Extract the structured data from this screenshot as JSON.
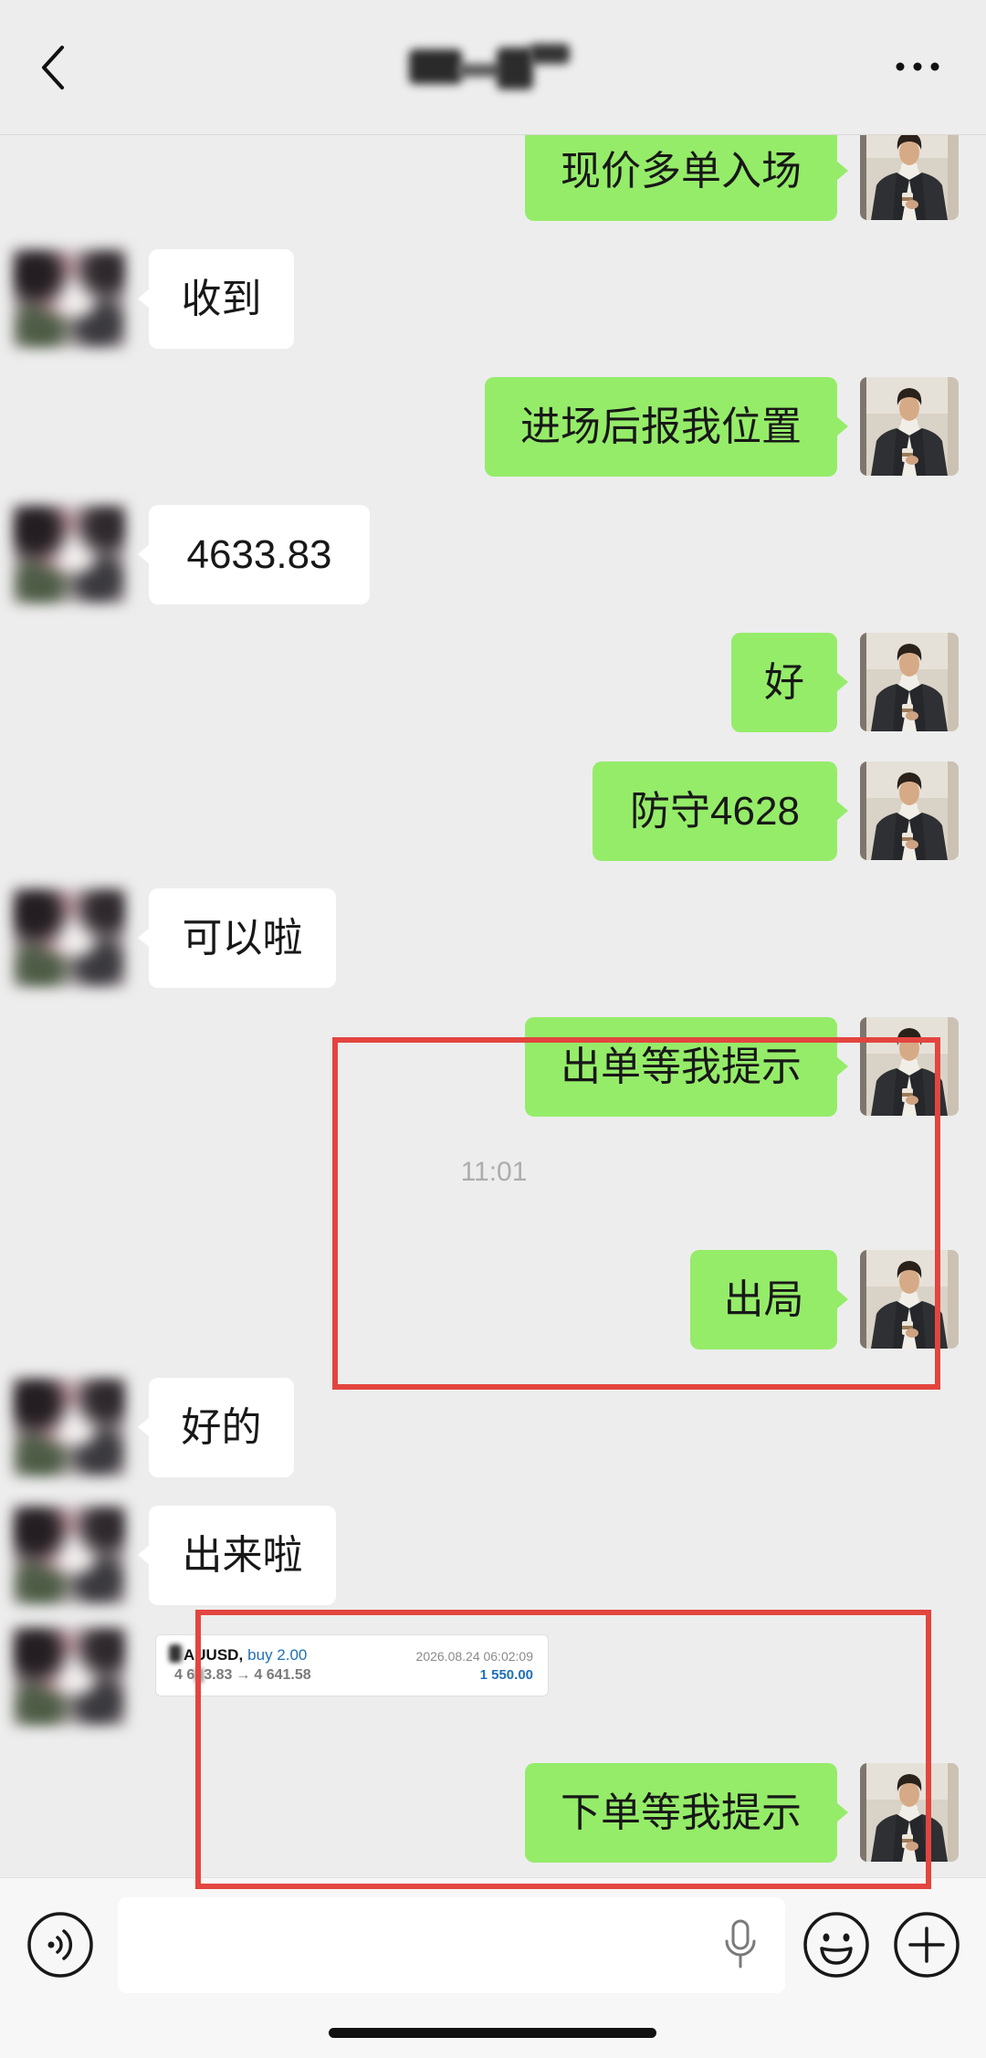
{
  "icons": {
    "back": "chevron-left-icon",
    "more": "more-icon",
    "voice": "voice-icon",
    "mic": "mic-icon",
    "emoji": "emoji-icon",
    "plus": "plus-icon"
  },
  "colors": {
    "background": "#ededed",
    "my_bubble": "#95ec69",
    "their_bubble": "#ffffff",
    "input_bar": "#f7f7f7",
    "annotation_red": "#e3453f",
    "trade_blue": "#1f70b8"
  },
  "messages": [
    {
      "outgoing": true,
      "text": "现价多单入场"
    },
    {
      "outgoing": false,
      "text": "收到"
    },
    {
      "outgoing": true,
      "text": "进场后报我位置"
    },
    {
      "outgoing": false,
      "text": "4633.83"
    },
    {
      "outgoing": true,
      "text": "好"
    },
    {
      "outgoing": true,
      "text": "防守4628"
    },
    {
      "outgoing": false,
      "text": "可以啦"
    },
    {
      "outgoing": true,
      "text": "出单等我提示"
    },
    {
      "outgoing": true,
      "text": "出局"
    },
    {
      "outgoing": false,
      "text": "好的"
    },
    {
      "outgoing": false,
      "text": "出来啦"
    },
    {
      "outgoing": true,
      "text": "下单等我提示"
    }
  ],
  "time_divider": "11:01",
  "trade_card": {
    "symbol": "AUUSD,",
    "direction_volume": "buy 2.00",
    "datetime": "2026.08.24 06:02:09",
    "open_price_start": "4 6",
    "open_price_end": "3.83",
    "arrow": "→",
    "close_price": "4 641.58",
    "profit": "1 550.00"
  },
  "input": {
    "value": ""
  }
}
